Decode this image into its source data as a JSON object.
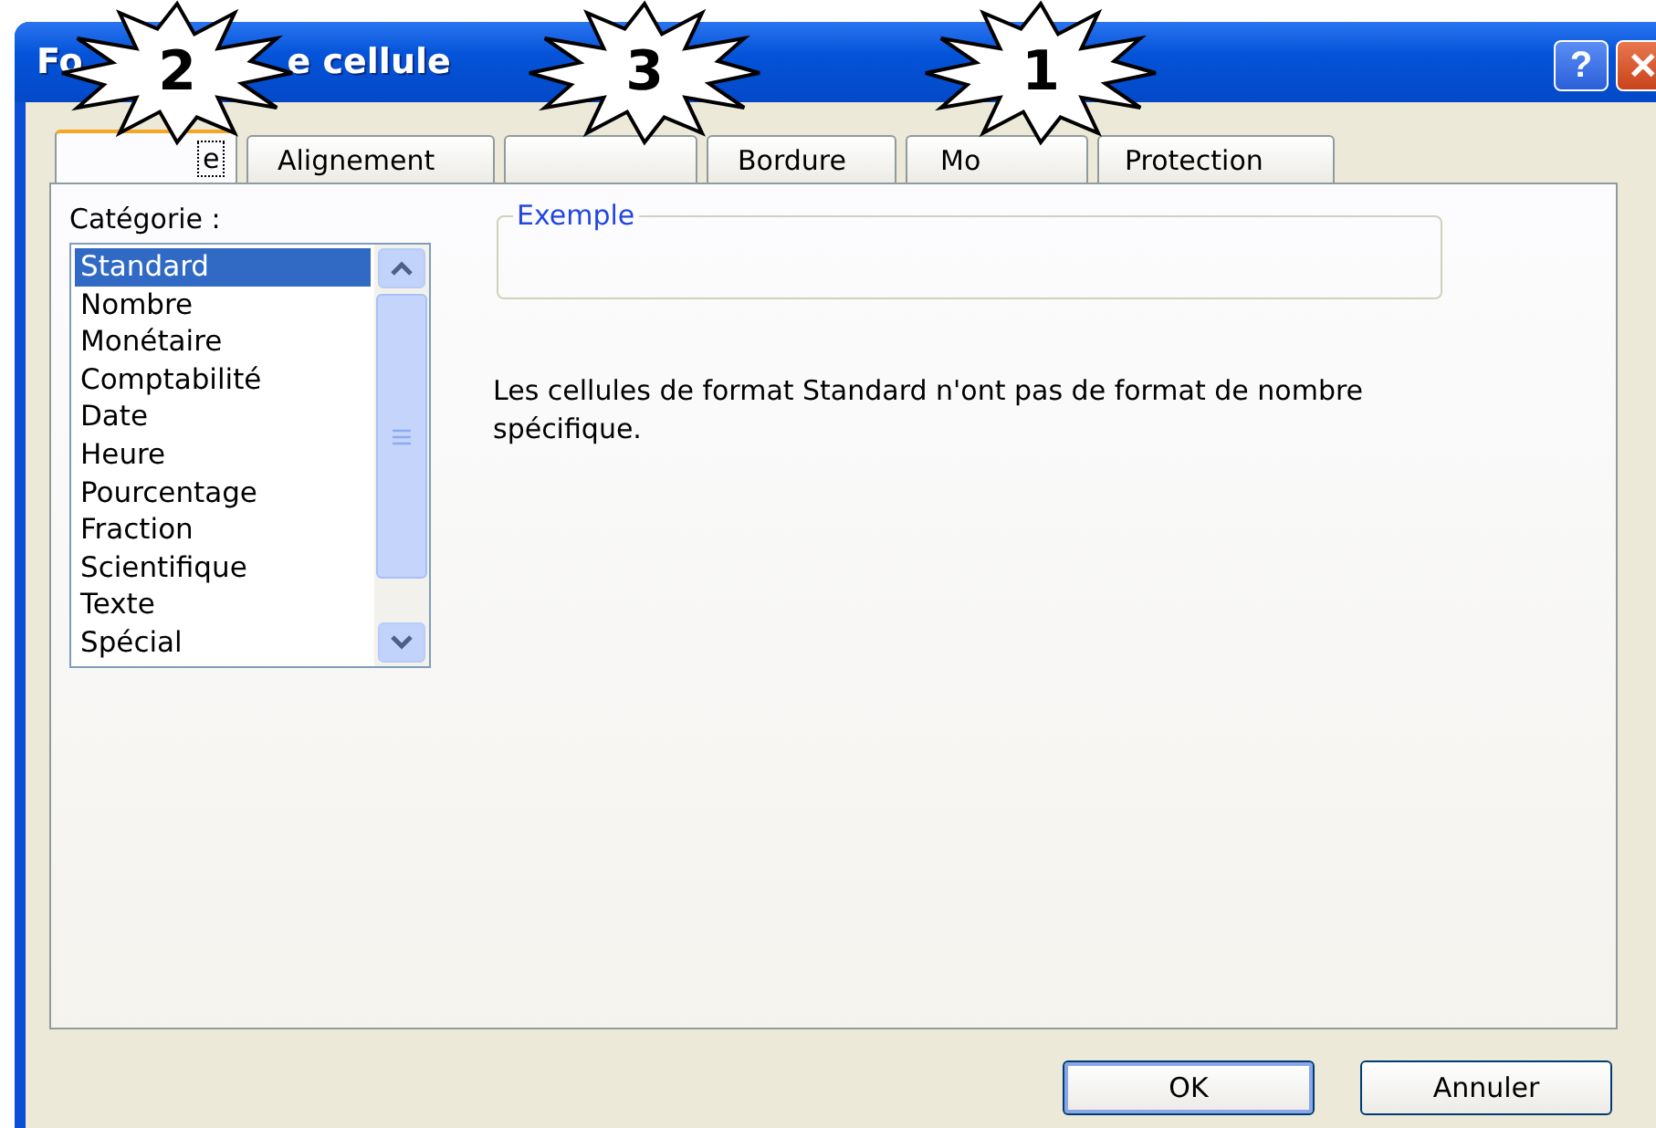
{
  "window": {
    "title_parts": [
      "Fo",
      "e cellule"
    ],
    "buttons": [
      {
        "kind": "help",
        "label": "?"
      },
      {
        "kind": "close",
        "label": "✕"
      }
    ]
  },
  "tabs": [
    {
      "label": "e",
      "selected": true
    },
    {
      "label": "Alignement",
      "selected": false
    },
    {
      "selected": false
    },
    {
      "label": "Bordure",
      "selected": false
    },
    {
      "label": "Mo",
      "selected": false
    },
    {
      "label": "Protection",
      "selected": false
    }
  ],
  "category": {
    "label": "Catégorie :",
    "items": [
      {
        "label": "Standard",
        "selected": true
      },
      {
        "label": "Nombre",
        "selected": false
      },
      {
        "label": "Monétaire",
        "selected": false
      },
      {
        "label": "Comptabilité",
        "selected": false
      },
      {
        "label": "Date",
        "selected": false
      },
      {
        "label": "Heure",
        "selected": false
      },
      {
        "label": "Pourcentage",
        "selected": false
      },
      {
        "label": "Fraction",
        "selected": false
      },
      {
        "label": "Scientifique",
        "selected": false
      },
      {
        "label": "Texte",
        "selected": false
      },
      {
        "label": "Spécial",
        "selected": false
      }
    ]
  },
  "sample": {
    "label": "Exemple"
  },
  "description": "Les cellules de format Standard n'ont pas de format de nombre spécifique.",
  "buttons": [
    {
      "label": "OK",
      "default": true
    },
    {
      "label": "Annuler",
      "default": false
    }
  ],
  "callouts": [
    {
      "number": "2"
    },
    {
      "number": "3"
    },
    {
      "number": "1"
    }
  ]
}
